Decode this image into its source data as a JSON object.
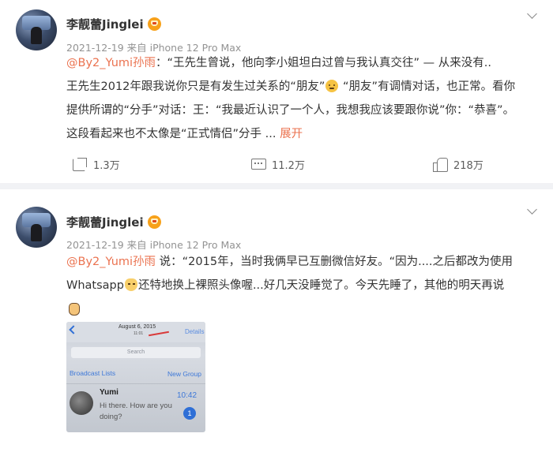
{
  "posts": [
    {
      "author": "李靓蕾Jinglei",
      "meta": "2021-12-19 来自 iPhone 12 Pro Max",
      "mention": "@By2_Yumi孙雨",
      "text_a": "：“王先生曾说，他向李小姐坦白过曾与我认真交往” — 从来没有..",
      "text_b": "王先生2012年跟我说你只是有发生过关系的“朋友”",
      "emoji_b": "thinking-face",
      "text_c": " “朋友”有调情对话，也正常。看你",
      "text_d": "提供所谓的“分手”对话：王：“我最近认识了一个人，我想我应该要跟你说”你：“恭喜”。",
      "text_e": "这段看起来也不太像是“正式情侣”分手 ... ",
      "expand": "展开",
      "share_count": "1.3万",
      "comment_count": "11.2万",
      "like_count": "218万"
    },
    {
      "author": "李靓蕾Jinglei",
      "meta": "2021-12-19 来自 iPhone 12 Pro Max",
      "mention": "@By2_Yumi孙雨",
      "text_a": " 说：“2015年，当时我俩早已互删微信好友。“因为....之后都改为使用",
      "text_b1": "Whatsapp",
      "emoji_b": "cat-face",
      "text_b2": "还特地换上裸照头像喔...好几天没睡觉了。今天先睡了，其他的明天再说",
      "emoji_c": "waving-hand",
      "image": {
        "date": "August 6, 2015",
        "time": "11:01",
        "details": "Details",
        "search_placeholder": "Search",
        "broadcast": "Broadcast Lists",
        "new_group": "New Group",
        "chat_name": "Yumi",
        "chat_message": "Hi there. How are you doing?",
        "chat_time": "10:42",
        "badge": "1"
      }
    }
  ]
}
